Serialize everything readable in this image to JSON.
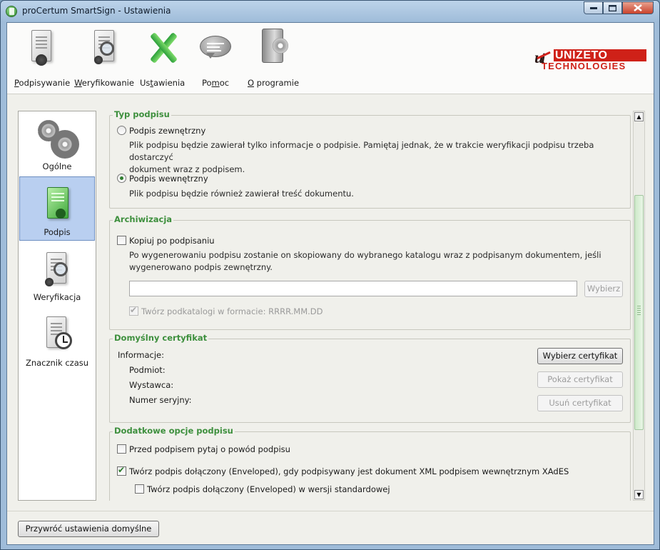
{
  "window": {
    "title": "proCertum SmartSign - Ustawienia"
  },
  "toolbar": {
    "sign": {
      "label": "odpisywanie",
      "underline": "P"
    },
    "verify": {
      "label": "eryfikowanie",
      "underline": "W"
    },
    "settings_pre": "Us",
    "settings_u": "t",
    "settings_post": "awienia",
    "help_pre": "Po",
    "help_u": "m",
    "help_post": "oc",
    "about_u": "O",
    "about_post": " programie"
  },
  "logo": {
    "name": "UNIZETO",
    "sub": "TECHNOLOGIES"
  },
  "nav": {
    "items": [
      {
        "label": "Ogólne",
        "icon": "gears-icon"
      },
      {
        "label": "Podpis",
        "icon": "signed-document-icon",
        "selected": true
      },
      {
        "label": "Weryfikacja",
        "icon": "verify-document-icon"
      },
      {
        "label": "Znacznik czasu",
        "icon": "timestamp-icon"
      }
    ]
  },
  "signature_type": {
    "title": "Typ podpisu",
    "external_label": "Podpis zewnętrzny",
    "external_desc1": "Plik podpisu będzie zawierał tylko informacje o podpisie. Pamiętaj jednak, że w trakcie weryfikacji podpisu trzeba dostarczyć",
    "external_desc2": "dokument wraz z podpisem.",
    "internal_label": "Podpis wewnętrzny",
    "internal_desc": "Plik podpisu będzie również zawierał treść dokumentu.",
    "selected": "internal"
  },
  "archive": {
    "title": "Archiwizacja",
    "copy_label": "Kopiuj po podpisaniu",
    "copy_checked": false,
    "desc1": "Po wygenerowaniu podpisu zostanie on skopiowany do wybranego katalogu wraz z podpisanym dokumentem, jeśli",
    "desc2": "wygenerowano podpis zewnętrzny.",
    "path_value": "",
    "browse_label": "Wybierz",
    "subdirs_label": "Twórz podkatalogi w formacie: RRRR.MM.DD",
    "subdirs_checked": true
  },
  "certificate": {
    "title": "Domyślny certyfikat",
    "info_label": "Informacje:",
    "subject_label": "Podmiot:",
    "issuer_label": "Wystawca:",
    "serial_label": "Numer seryjny:",
    "select_btn": "Wybierz certyfikat",
    "show_btn": "Pokaż certyfikat",
    "remove_btn": "Usuń certyfikat"
  },
  "extra": {
    "title": "Dodatkowe opcje podpisu",
    "ask_reason_label": "Przed podpisem pytaj o powód podpisu",
    "ask_reason_checked": false,
    "enveloped_label": "Twórz podpis dołączony (Enveloped), gdy podpisywany jest dokument XML podpisem wewnętrznym XAdES",
    "enveloped_checked": true,
    "enveloped_std_label": "Twórz podpis dołączony (Enveloped) w wersji standardowej",
    "enveloped_std_checked": false
  },
  "footer": {
    "restore_defaults": "Przywróć ustawienia domyślne"
  },
  "colors": {
    "group_title": "#3d8f3d",
    "nav_selected": "#b9cff0",
    "logo_red": "#cf2118"
  }
}
